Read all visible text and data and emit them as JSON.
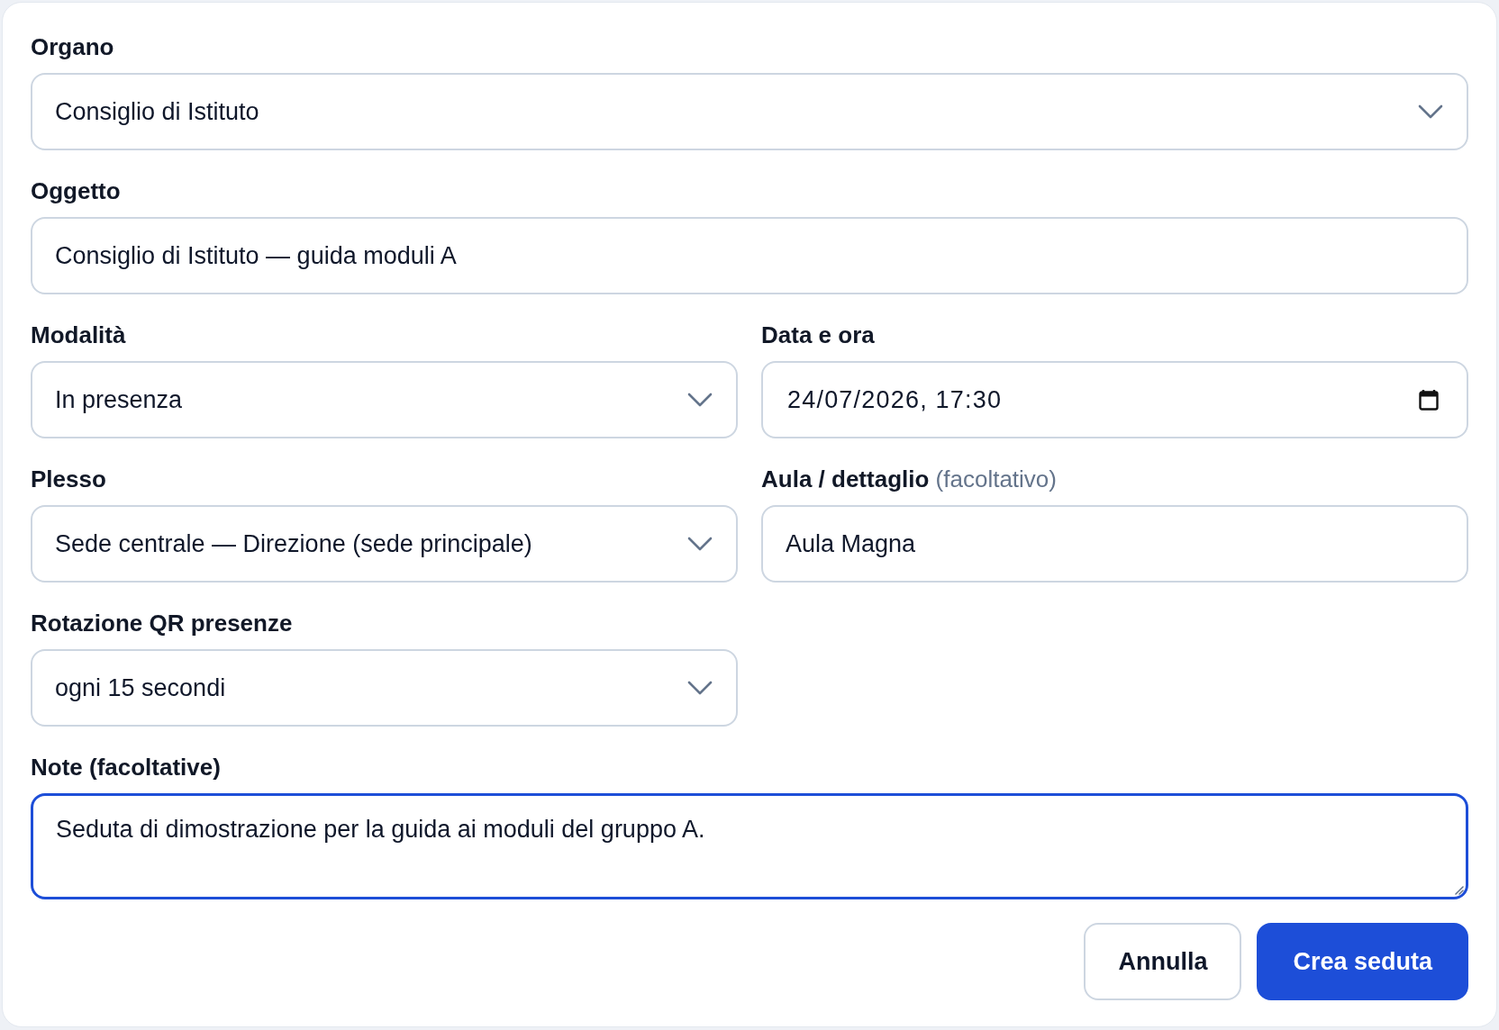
{
  "form": {
    "fields": [
      {
        "kind": "select",
        "label": "Organo",
        "value": "Consiglio di Istituto",
        "wide": true,
        "focused": false
      },
      {
        "kind": "input",
        "label": "Oggetto",
        "value": "Consiglio di Istituto — guida moduli A",
        "wide": true,
        "focused": false
      },
      {
        "kind": "select",
        "label": "Modalità",
        "value": "In presenza",
        "wide": false,
        "focused": false
      },
      {
        "kind": "datetime",
        "label": "Data e ora",
        "value": "24/07/2026, 17:30",
        "wide": false,
        "focused": false
      },
      {
        "kind": "select",
        "label": "Plesso",
        "value": "Sede centrale — Direzione (sede principale)",
        "wide": false,
        "focused": false
      },
      {
        "kind": "input",
        "label": "Aula / dettaglio",
        "hint": "(facoltativo)",
        "value": "Aula Magna",
        "wide": false,
        "focused": false
      },
      {
        "kind": "select",
        "label": "Rotazione QR presenze",
        "value": "ogni 15 secondi",
        "wide": false,
        "focused": false
      },
      {
        "kind": "textarea",
        "label": "Note (facoltative)",
        "value": "Seduta di dimostrazione per la guida ai moduli del gruppo A.",
        "wide": true,
        "focused": true
      }
    ],
    "buttons": [
      {
        "label": "Annulla",
        "kind": "secondary"
      },
      {
        "label": "Crea seduta",
        "kind": "primary"
      }
    ]
  }
}
